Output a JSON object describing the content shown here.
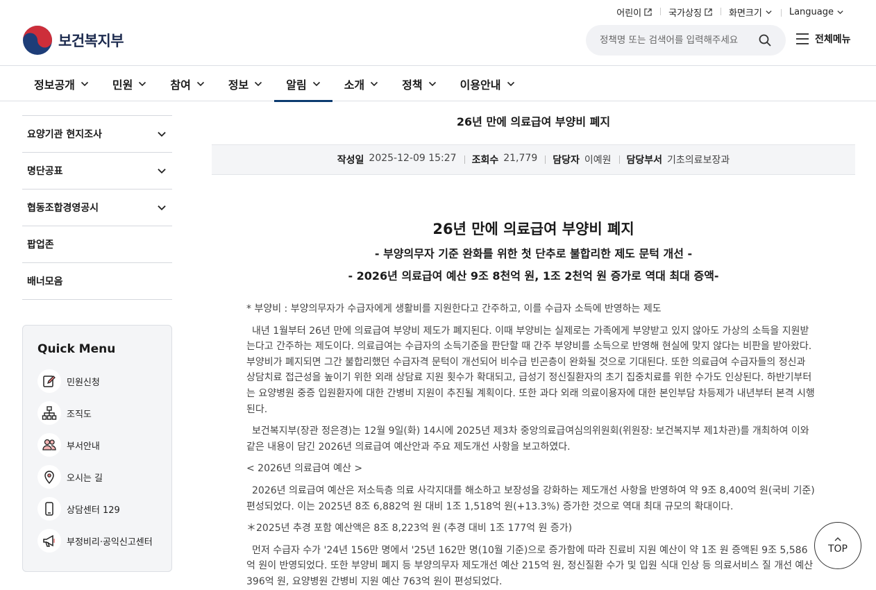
{
  "utility": {
    "kids": "어린이",
    "symbols": "국가상징",
    "screen_size": "화면크기",
    "language": "Language"
  },
  "header": {
    "logo_text": "보건복지부",
    "search_placeholder": "정책명 또는 검색어를 입력해주세요",
    "all_menu": "전체메뉴"
  },
  "gnb": [
    {
      "label": "정보공개"
    },
    {
      "label": "민원"
    },
    {
      "label": "참여"
    },
    {
      "label": "정보"
    },
    {
      "label": "알림",
      "active": true
    },
    {
      "label": "소개"
    },
    {
      "label": "정책"
    },
    {
      "label": "이용안내"
    }
  ],
  "lnb": [
    {
      "label": "요양기관 현지조사",
      "expandable": true
    },
    {
      "label": "명단공표",
      "expandable": true
    },
    {
      "label": "협동조합경영공시",
      "expandable": true
    },
    {
      "label": "팝업존",
      "expandable": false
    },
    {
      "label": "배너모음",
      "expandable": false
    }
  ],
  "quick_menu": {
    "title": "Quick Menu",
    "items": [
      {
        "label": "민원신청",
        "icon": "edit-icon"
      },
      {
        "label": "조직도",
        "icon": "org-chart-icon"
      },
      {
        "label": "부서안내",
        "icon": "people-icon"
      },
      {
        "label": "오시는 길",
        "icon": "location-pin-icon"
      },
      {
        "label": "상담센터 129",
        "icon": "phone-icon"
      },
      {
        "label": "부정비리·공익신고센터",
        "icon": "megaphone-icon"
      }
    ]
  },
  "post": {
    "title": "26년 만에 의료급여 부양비 폐지",
    "meta": {
      "date_label": "작성일",
      "date": "2025-12-09 15:27",
      "views_label": "조회수",
      "views": "21,779",
      "author_label": "담당자",
      "author": "이예원",
      "dept_label": "담당부서",
      "dept": "기초의료보장과"
    },
    "headline": "26년 만에 의료급여 부양비 폐지",
    "subhead1": "- 부양의무자 기준 완화를 위한 첫 단추로 불합리한 제도 문턱 개선 -",
    "subhead2": "- 2026년 의료급여 예산 9조 8천억 원, 1조 2천억 원 증가로 역대 최대 증액-",
    "paragraphs": [
      "* 부양비 : 부양의무자가 수급자에게 생활비를 지원한다고 간주하고, 이를 수급자 소득에 반영하는 제도",
      "내년 1월부터 26년 만에 의료급여 부양비 제도가 폐지된다. 이때 부양비는 실제로는 가족에게 부양받고 있지 않아도 가상의 소득을 지원받는다고 간주하는 제도이다. 의료급여는 수급자의 소득기준을 판단할 때 간주 부양비를 소득으로 반영해 현실에 맞지 않다는 비판을 받아왔다. 부양비가 폐지되면 그간 불합리했던 수급자격 문턱이 개선되어 비수급 빈곤층이 완화될 것으로 기대된다. 또한 의료급여 수급자들의 정신과 상담치료 접근성을 높이기 위한 외래 상담료 지원 횟수가 확대되고, 급성기 정신질환자의 초기 집중치료를 위한 수가도 인상된다. 하반기부터는 요양병원 중증 입원환자에 대한 간병비 지원이 추진될 계획이다. 또한 과다 외래 의료이용자에 대한 본인부담 차등제가 내년부터 본격 시행된다.",
      "보건복지부(장관 정은경)는 12월 9일(화) 14시에 2025년 제3차 중앙의료급여심의위원회(위원장: 보건복지부 제1차관)를 개최하여 이와 같은 내용이 담긴 2026년 의료급여 예산안과 주요 제도개선 사항을 보고하였다.",
      "< 2026년 의료급여 예산 >",
      "2026년 의료급여 예산은 저소득층 의료 사각지대를 해소하고 보장성을 강화하는 제도개선 사항을 반영하여 약 9조 8,400억 원(국비 기준) 편성되었다. 이는 2025년 8조 6,882억 원 대비 1조 1,518억 원(+13.3%) 증가한 것으로 역대 최대 규모의 확대이다.",
      "＊2025년 추경 포함 예산액은 8조 8,223억 원 (추경 대비 1조 177억 원 증가)",
      "먼저 수급자 수가 '24년 156만 명에서 '25년 162만 명(10월 기준)으로 증가함에 따라 진료비 지원 예산이 약 1조 원 증액된 9조 5,586억 원이 반영되었다. 또한 부양비 폐지 등 부양의무자 제도개선 예산 215억 원, 정신질환 수가 및 입원 식대 인상 등 의료서비스 질 개선 예산 396억 원, 요양병원 간병비 지원 예산 763억 원이 편성되었다."
    ]
  },
  "top_button": "TOP"
}
